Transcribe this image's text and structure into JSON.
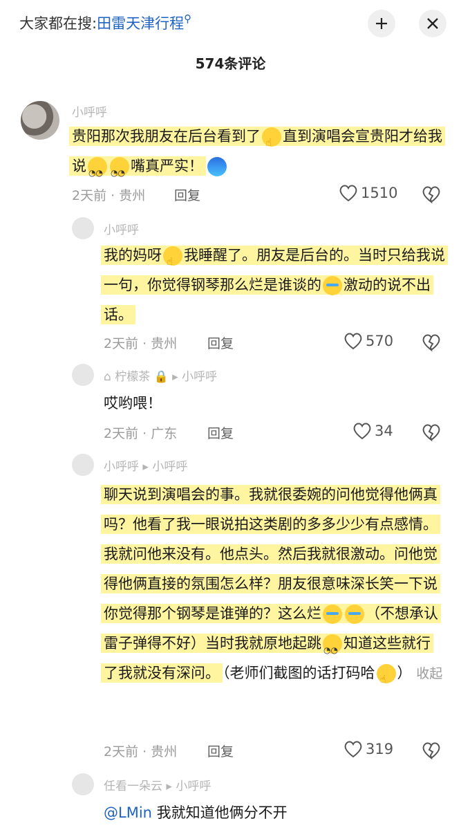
{
  "header": {
    "search_prefix": "大家都在搜:",
    "search_keyword": "田雷天津行程",
    "comment_count": "574条评论"
  },
  "comments": [
    {
      "username": "小呼呼",
      "body": [
        "贵阳那次我朋友在后台看到了",
        "直到演唱会宣贵阳才给我说",
        "嘴真严实！"
      ],
      "time_location": "2天前 · 贵州",
      "reply_label": "回复",
      "likes": "1510"
    },
    {
      "username": "小呼呼",
      "body": [
        "我的妈呀",
        "我睡醒了。朋友是后台的。当时只给我说一句，你觉得钢琴那么烂是谁谈的",
        "激动的说不出话。"
      ],
      "time_location": "2天前 · 贵州",
      "reply_label": "回复",
      "likes": "570"
    },
    {
      "username": "柠檬茶",
      "reply_to": "小呼呼",
      "body": [
        "哎哟喂！"
      ],
      "time_location": "2天前 · 广东",
      "reply_label": "回复",
      "likes": "34"
    },
    {
      "username": "小呼呼",
      "reply_to": "小呼呼",
      "body": [
        "聊天说到演唱会的事。我就很委婉的问他觉得他俩真吗？他看了我一眼说拍这类剧的多多少少有点感情。我就问他来没有。他点头。然后我就很激动。问他觉得他俩直接的氛围怎么样？朋友很意味深长笑一下说你觉得那个钢琴是谁弹的？这么烂",
        "（不想承认雷子弹得不好）当时我就原地起跳",
        "知道这些就行了我就没有深问。",
        "（老师们截图的话打码哈",
        "）"
      ],
      "collapse_label": "收起",
      "time_location": "2天前 · 贵州",
      "reply_label": "回复",
      "likes": "319"
    },
    {
      "username": "任看一朵云",
      "reply_to": "小呼呼",
      "mention": "@LMin",
      "body": [
        "我就知道他俩分不开"
      ]
    }
  ],
  "colors": {
    "highlight": "#fff4a0",
    "link": "#1e63c4"
  }
}
